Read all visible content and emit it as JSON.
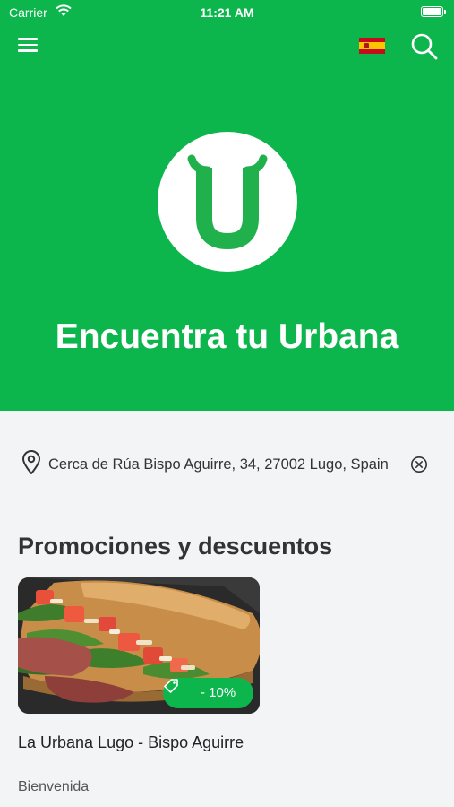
{
  "status_bar": {
    "carrier": "Carrier",
    "time": "11:21 AM"
  },
  "header": {
    "menu_icon": "hamburger-menu-icon",
    "language_icon": "spain-flag-icon",
    "search_icon": "search-icon"
  },
  "hero": {
    "logo": "urbana-logo",
    "title": "Encuentra tu Urbana"
  },
  "location": {
    "text": "Cerca de Rúa Bispo Aguirre, 34, 27002 Lugo, Spain",
    "icon": "location-pin-icon",
    "clear_icon": "clear-circle-icon"
  },
  "promotions": {
    "section_title": "Promociones y descuentos",
    "items": [
      {
        "name": "La Urbana Lugo - Bispo Aguirre",
        "subtitle": "Bienvenida",
        "discount": "- 10%",
        "image": "sandwich-photo"
      }
    ]
  },
  "colors": {
    "brand_green": "#0cb64c",
    "background": "#f3f4f6",
    "text_dark": "#333333"
  }
}
